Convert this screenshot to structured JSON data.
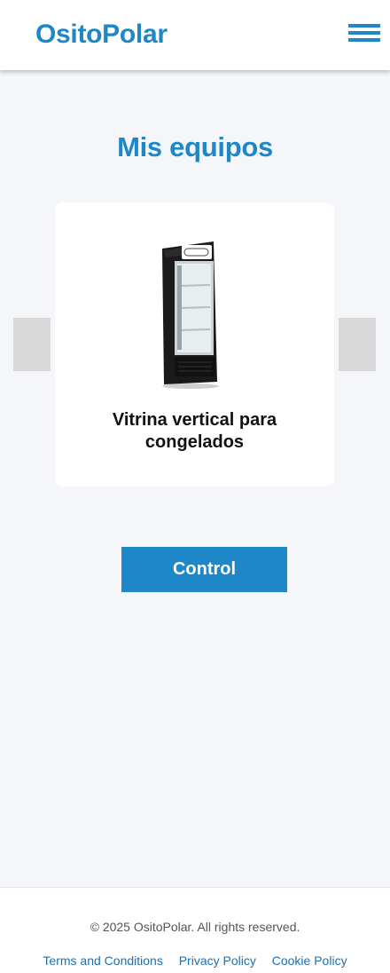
{
  "header": {
    "brand": "OsitoPolar",
    "menu_icon": "hamburger-menu-icon"
  },
  "main": {
    "title": "Mis equipos",
    "carousel": {
      "prev_icon": "chevron-left-icon",
      "next_icon": "chevron-right-icon",
      "item": {
        "name": "Vitrina vertical para congelados",
        "image": "vertical-freezer-display-image"
      }
    },
    "control_label": "Control"
  },
  "colors": {
    "brand": "#1e87c8",
    "background": "#f4f6fa",
    "card": "#ffffff",
    "arrow": "#d9d9d9"
  },
  "footer": {
    "copyright": "© 2025 OsitoPolar. All rights reserved.",
    "links": [
      "Terms and Conditions",
      "Privacy Policy",
      "Cookie Policy"
    ]
  }
}
